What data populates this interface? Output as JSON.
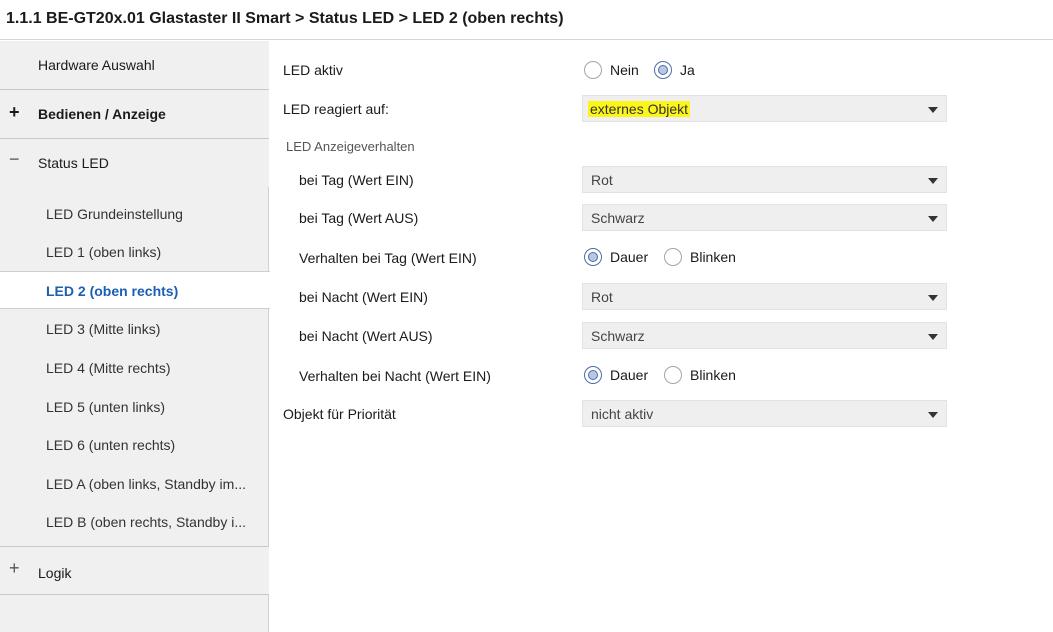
{
  "breadcrumb": "1.1.1 BE-GT20x.01 Glastaster II Smart > Status LED > LED 2 (oben rechts)",
  "sidebar": {
    "hardware": "Hardware Auswahl",
    "bedienen": {
      "sign": "+",
      "label": "Bedienen / Anzeige"
    },
    "status_led": {
      "sign": "−",
      "label": "Status LED"
    },
    "sub_items": [
      "LED Grundeinstellung",
      "LED 1 (oben links)",
      "LED 2 (oben rechts)",
      "LED 3 (Mitte links)",
      "LED 4 (Mitte rechts)",
      "LED 5 (unten links)",
      "LED 6 (unten rechts)",
      "LED A (oben links, Standby im...",
      "LED B (oben rechts, Standby i..."
    ],
    "active_sub": "LED 2 (oben rechts)",
    "logik": {
      "sign": "+",
      "label": "Logik"
    }
  },
  "form": {
    "led_aktiv": {
      "label": "LED aktiv",
      "options": [
        "Nein",
        "Ja"
      ],
      "selected": "Ja"
    },
    "reagiert": {
      "label": "LED reagiert auf:",
      "value": "externes Objekt"
    },
    "group_label": "LED Anzeigeverhalten",
    "tag_ein": {
      "label": "bei Tag (Wert EIN)",
      "value": "Rot"
    },
    "tag_aus": {
      "label": "bei Tag (Wert AUS)",
      "value": "Schwarz"
    },
    "verhalten_tag": {
      "label": "Verhalten bei Tag (Wert EIN)",
      "options": [
        "Dauer",
        "Blinken"
      ],
      "selected": "Dauer"
    },
    "nacht_ein": {
      "label": "bei Nacht (Wert EIN)",
      "value": "Rot"
    },
    "nacht_aus": {
      "label": "bei Nacht (Wert AUS)",
      "value": "Schwarz"
    },
    "verhalten_nacht": {
      "label": "Verhalten bei Nacht (Wert EIN)",
      "options": [
        "Dauer",
        "Blinken"
      ],
      "selected": "Dauer"
    },
    "prioritaet": {
      "label": "Objekt für Priorität",
      "value": "nicht aktiv"
    }
  },
  "colors": {
    "highlight": "#fbf519",
    "active_text": "#1a5fb4",
    "sidebar_bg": "#f0f0f0"
  }
}
